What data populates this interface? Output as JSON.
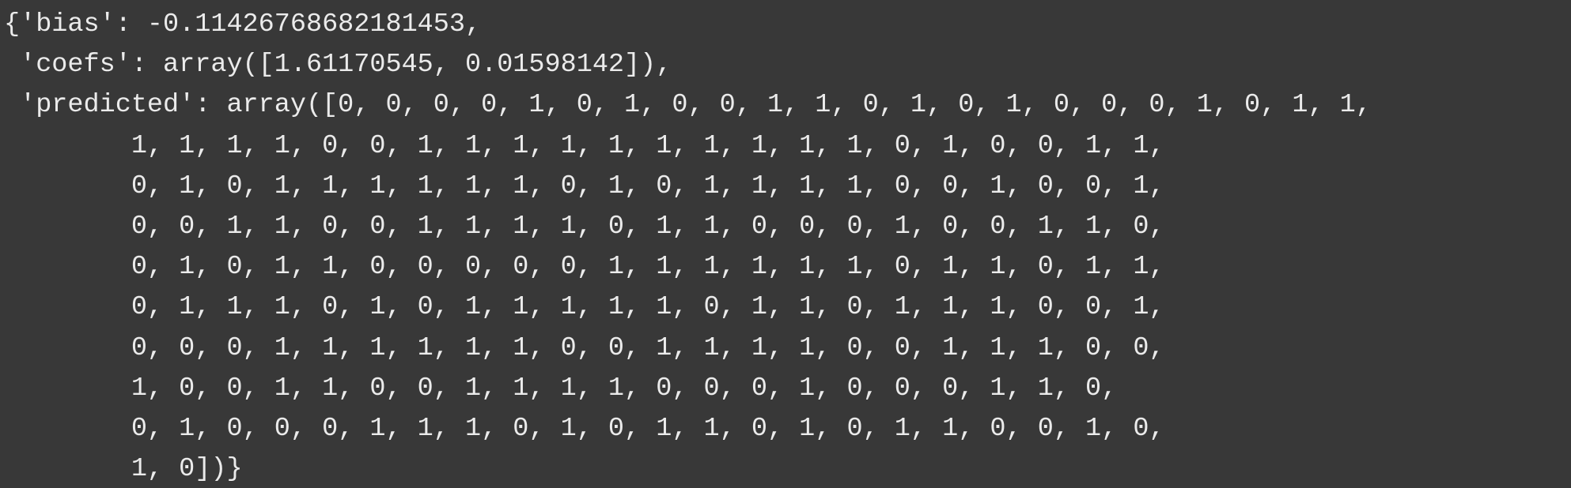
{
  "output": {
    "lines": [
      "{'bias': -0.11426768682181453,",
      " 'coefs': array([1.61170545, 0.01598142]),",
      " 'predicted': array([0, 0, 0, 0, 1, 0, 1, 0, 0, 1, 1, 0, 1, 0, 1, 0, 0, 0, 1, 0, 1, 1,",
      "        1, 1, 1, 1, 0, 0, 1, 1, 1, 1, 1, 1, 1, 1, 1, 1, 0, 1, 0, 0, 1, 1,",
      "        0, 1, 0, 1, 1, 1, 1, 1, 1, 0, 1, 0, 1, 1, 1, 1, 0, 0, 1, 0, 0, 1,",
      "        0, 0, 1, 1, 0, 0, 1, 1, 1, 1, 0, 1, 1, 0, 0, 0, 1, 0, 0, 1, 1, 0,",
      "        0, 1, 0, 1, 1, 0, 0, 0, 0, 0, 1, 1, 1, 1, 1, 1, 0, 1, 1, 0, 1, 1,",
      "        0, 1, 1, 1, 0, 1, 0, 1, 1, 1, 1, 1, 0, 1, 1, 0, 1, 1, 1, 0, 0, 1,",
      "        0, 0, 0, 1, 1, 1, 1, 1, 1, 0, 0, 1, 1, 1, 1, 0, 0, 1, 1, 1, 0, 0,",
      "        1, 0, 0, 1, 1, 0, 0, 1, 1, 1, 1, 0, 0, 0, 1, 0, 0, 0, 1, 1, 0,",
      "        0, 1, 0, 0, 0, 1, 1, 1, 0, 1, 0, 1, 1, 0, 1, 0, 1, 1, 0, 0, 1, 0,",
      "        1, 0])}"
    ]
  }
}
